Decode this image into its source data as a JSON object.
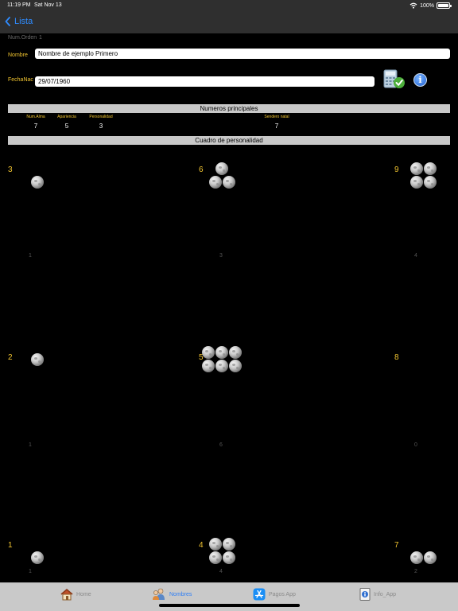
{
  "status": {
    "time": "11:19 PM",
    "date": "Sat Nov 13",
    "battery": "100%",
    "battery_level": 1.0
  },
  "nav": {
    "back_label": "Lista"
  },
  "form": {
    "num_orden_label": "Num.Orden",
    "num_orden_value": "1",
    "nombre_label": "Nombre",
    "nombre_value": "Nombre de ejemplo Primero",
    "fecha_label": "FechaNac",
    "fecha_value": "29/07/1960"
  },
  "numeros": {
    "title": "Numeros principales",
    "items": [
      {
        "label": "Num.Alma",
        "value": "7"
      },
      {
        "label": "Apariencia",
        "value": "5"
      },
      {
        "label": "Personalidad",
        "value": "3"
      },
      {
        "label": "Sendero natal",
        "value": "7"
      }
    ]
  },
  "cuadro": {
    "title": "Cuadro de personalidad",
    "cells": [
      {
        "number": "3",
        "count": "1"
      },
      {
        "number": "6",
        "count": "3"
      },
      {
        "number": "9",
        "count": "4"
      },
      {
        "number": "2",
        "count": "1"
      },
      {
        "number": "5",
        "count": "6"
      },
      {
        "number": "8",
        "count": "0"
      },
      {
        "number": "1",
        "count": "1"
      },
      {
        "number": "4",
        "count": "4"
      },
      {
        "number": "7",
        "count": "2"
      }
    ]
  },
  "tabs": [
    {
      "label": "Home",
      "icon": "house-icon"
    },
    {
      "label": "Nombres",
      "icon": "people-icon"
    },
    {
      "label": "Pagos App",
      "icon": "app-store-icon"
    },
    {
      "label": "Info_App",
      "icon": "info-document-icon"
    }
  ],
  "colors": {
    "accent": "#2f8cff",
    "label_yellow": "#f2c530",
    "section_bar": "#c8c8c8",
    "tabbar": "#c9c9c9"
  }
}
